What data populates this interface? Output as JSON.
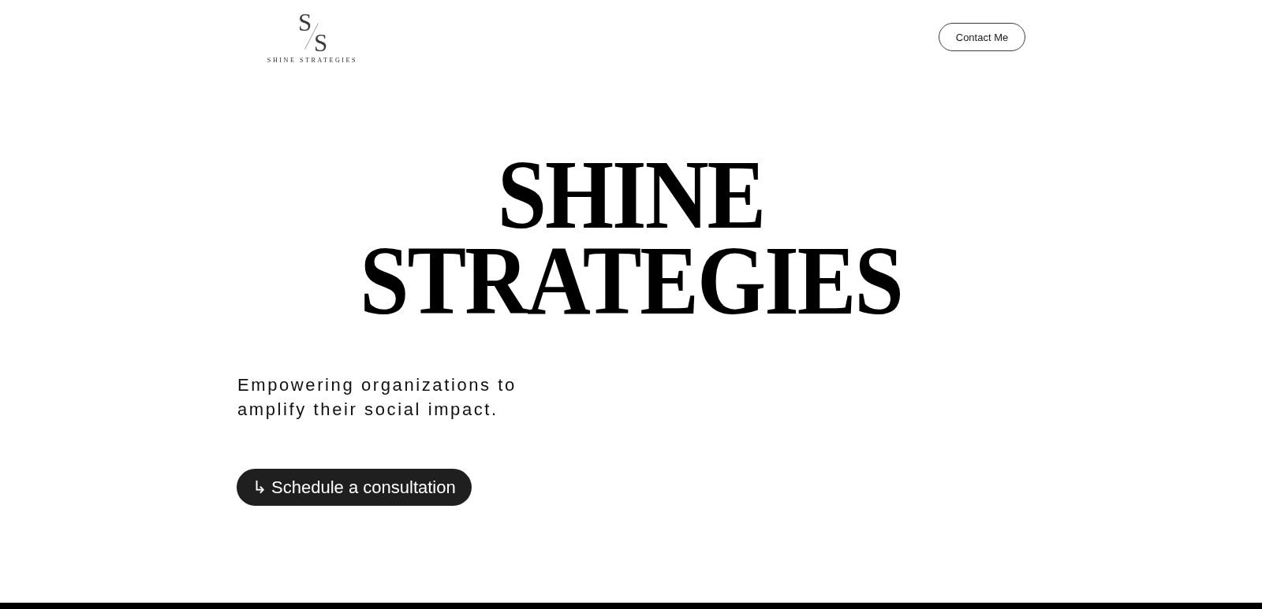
{
  "header": {
    "logo": {
      "monogram_top": "S",
      "monogram_bottom": "S",
      "wordmark": "SHINE STRATEGIES"
    },
    "contact_button": "Contact Me"
  },
  "hero": {
    "headline": [
      "SHINE",
      "STRATEGIES"
    ],
    "tagline": "Empowering organizations to amplify their social impact.",
    "cta_button": "↳ Schedule a consultation"
  }
}
